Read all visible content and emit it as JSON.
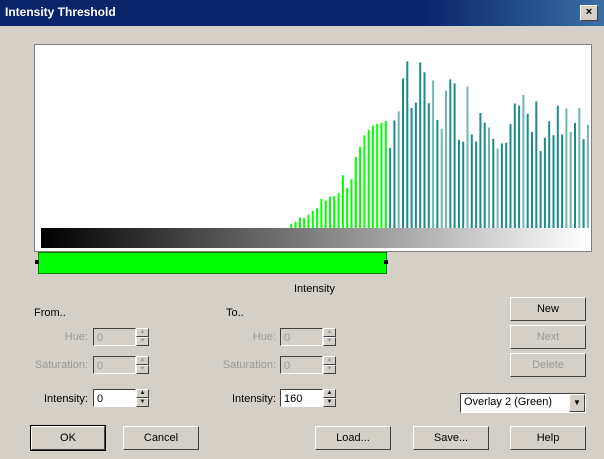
{
  "window": {
    "title": "Intensity Threshold",
    "close_icon": "close-icon"
  },
  "histogram": {
    "caption": "Intensity",
    "colors": {
      "selected": "#00ff00",
      "unselected": "#1a8a8a",
      "unselected_light": "#6fb7b0"
    },
    "selection_range": [
      0,
      160
    ],
    "max_intensity": 255
  },
  "from": {
    "group_label": "From..",
    "hue": {
      "label": "Hue:",
      "value": "0"
    },
    "saturation": {
      "label": "Saturation:",
      "value": "0"
    },
    "intensity": {
      "label": "Intensity:",
      "value": "0"
    }
  },
  "to": {
    "group_label": "To..",
    "hue": {
      "label": "Hue:",
      "value": "0"
    },
    "saturation": {
      "label": "Saturation:",
      "value": "0"
    },
    "intensity": {
      "label": "Intensity:",
      "value": "160"
    }
  },
  "side_buttons": {
    "new": "New",
    "next": "Next",
    "delete": "Delete"
  },
  "overlay": {
    "selected": "Overlay 2 (Green)"
  },
  "footer": {
    "ok": "OK",
    "cancel": "Cancel",
    "load": "Load...",
    "save": "Save...",
    "help": "Help"
  }
}
